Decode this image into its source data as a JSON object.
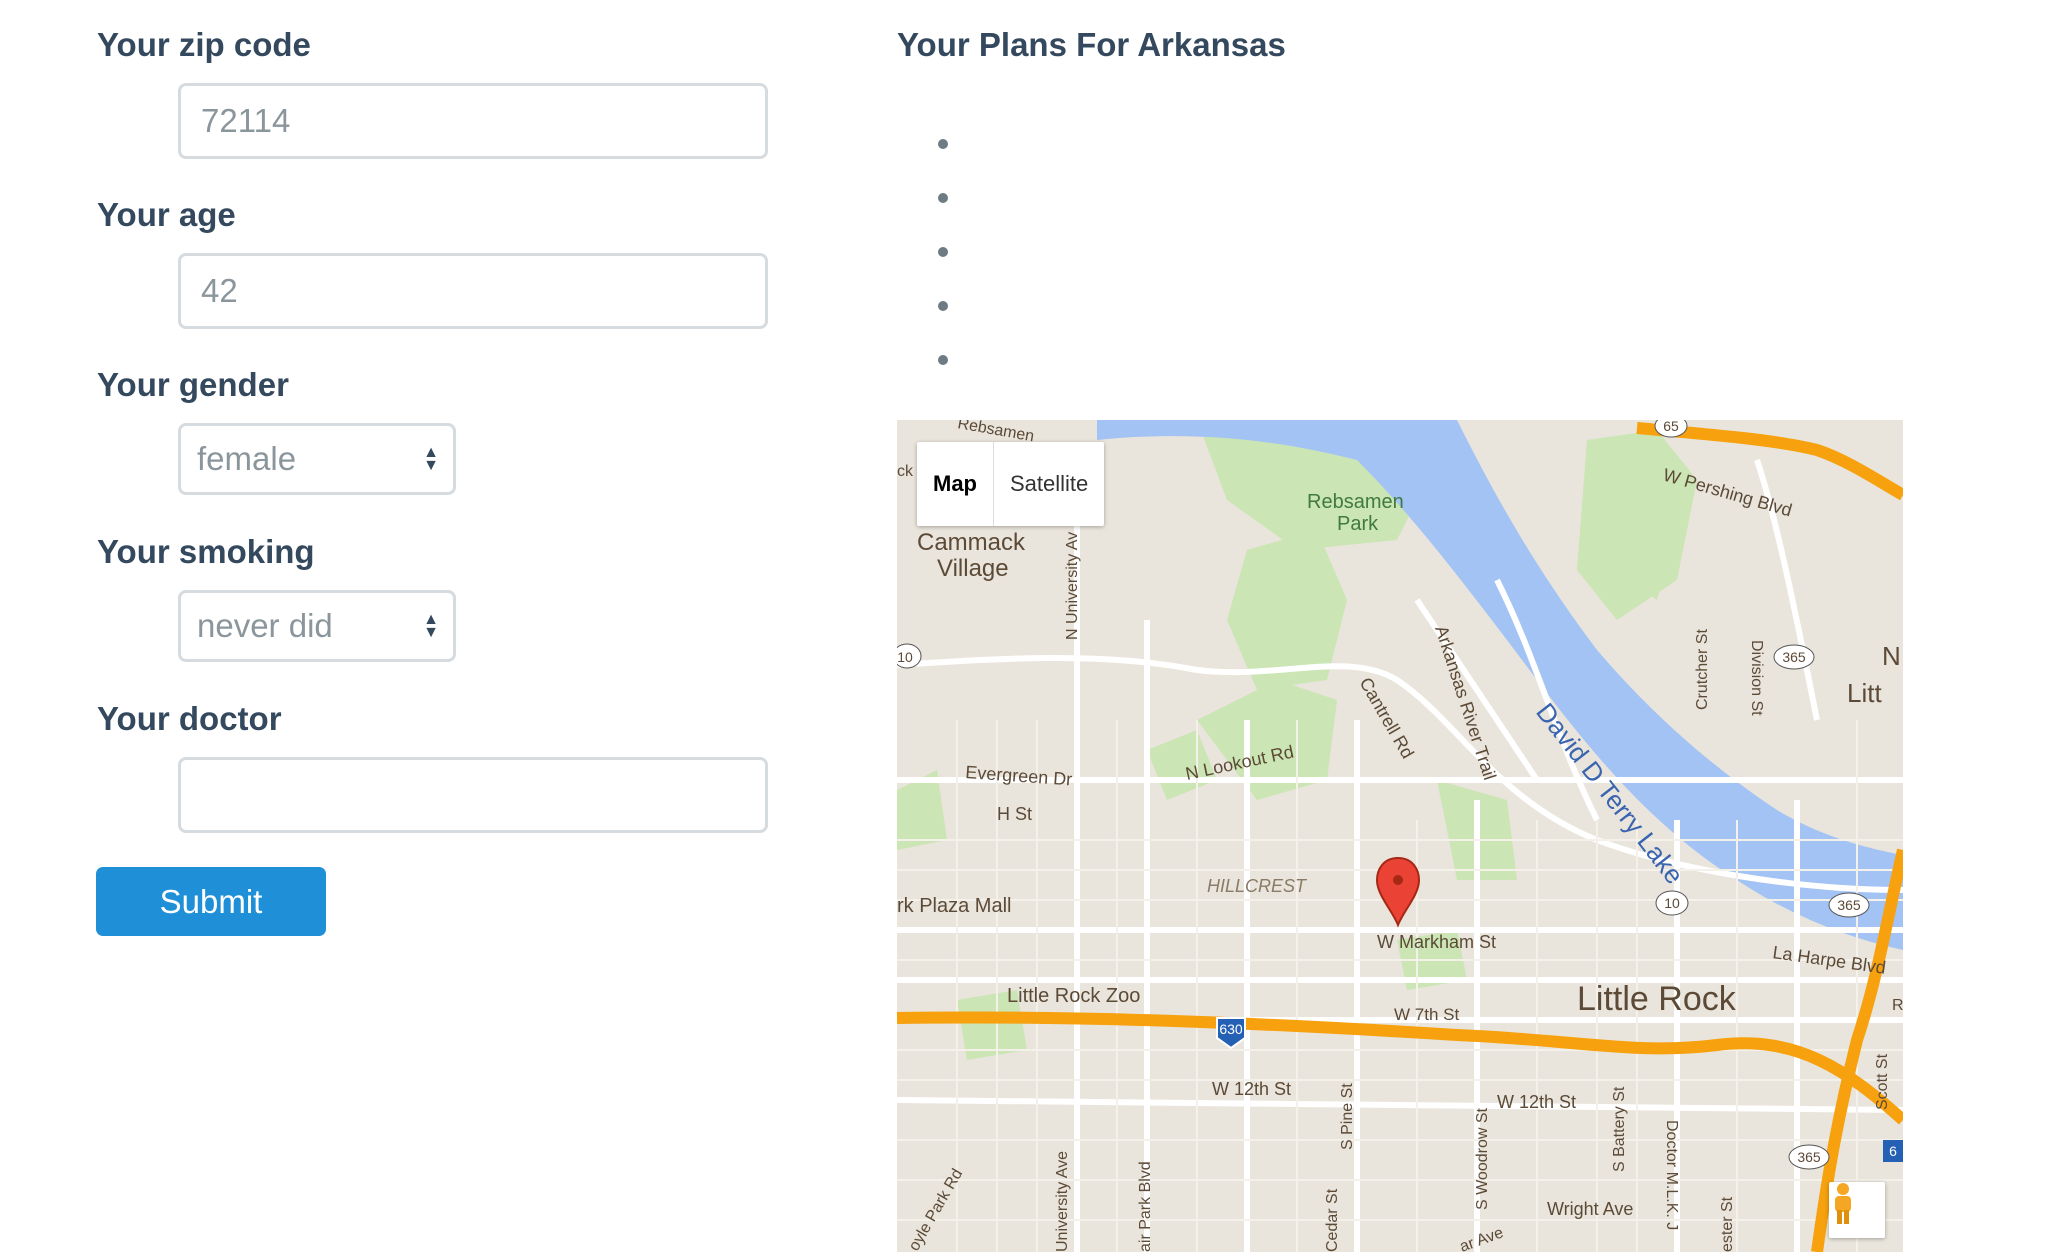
{
  "form": {
    "zip": {
      "label": "Your zip code",
      "value": "72114"
    },
    "age": {
      "label": "Your age",
      "value": "42"
    },
    "gender": {
      "label": "Your gender",
      "value": "female"
    },
    "smoking": {
      "label": "Your smoking",
      "value": "never did"
    },
    "doctor": {
      "label": "Your doctor",
      "value": ""
    },
    "submit_label": "Submit"
  },
  "plans": {
    "title": "Your Plans For Arkansas",
    "items": [
      "",
      "",
      "",
      "",
      ""
    ]
  },
  "map": {
    "type_controls": {
      "map": "Map",
      "satellite": "Satellite"
    },
    "labels": {
      "cammack_1": "Cammack",
      "cammack_2": "Village",
      "rebsamen_1": "Rebsamen",
      "rebsamen_2": "Park",
      "rebsamen_top": "Rebsamen",
      "n_university": "N University Av",
      "evergreen": "Evergreen Dr",
      "h_st": "H St",
      "n_lookout": "N Lookout Rd",
      "cantrell": "Cantrell Rd",
      "arkansas_trail": "Arkansas River Trail",
      "lake": "David D Terry Lake",
      "pershing": "W Pershing Blvd",
      "crutcher": "Crutcher St",
      "division": "Division St",
      "hillcrest": "HILLCREST",
      "park_plaza": "rk Plaza Mall",
      "markham": "W Markham St",
      "la_harpe": "La Harpe Blvd",
      "little_rock": "Little Rock",
      "n_litt_1": "N",
      "n_litt_2": "Litt",
      "zoo": "Little Rock Zoo",
      "w7th": "W 7th St",
      "w12th_a": "W 12th St",
      "w12th_b": "W 12th St",
      "s_pine": "S Pine St",
      "s_woodrow": "S Woodrow St",
      "s_battery": "S Battery St",
      "doctor_mlk": "Doctor M.L.K. J",
      "wright": "Wright Ave",
      "university_ave": "University Ave",
      "park_rd": "oyle Park Rd",
      "fair_park": "air Park Blvd",
      "cedar": "Cedar St",
      "chester": "ester St",
      "scott": "Scott St",
      "ck": "ck",
      "r": "R",
      "ar_ave": "ar Ave",
      "i630": "630",
      "r10a": "10",
      "r10b": "10",
      "r365a": "365",
      "r365b": "365",
      "r365c": "365",
      "r65": "65",
      "r6x": "6"
    },
    "colors": {
      "water": "#a3c3f5",
      "park": "#cbe5b4",
      "highway": "#f6a10d",
      "base": "#e9e5dc"
    }
  }
}
